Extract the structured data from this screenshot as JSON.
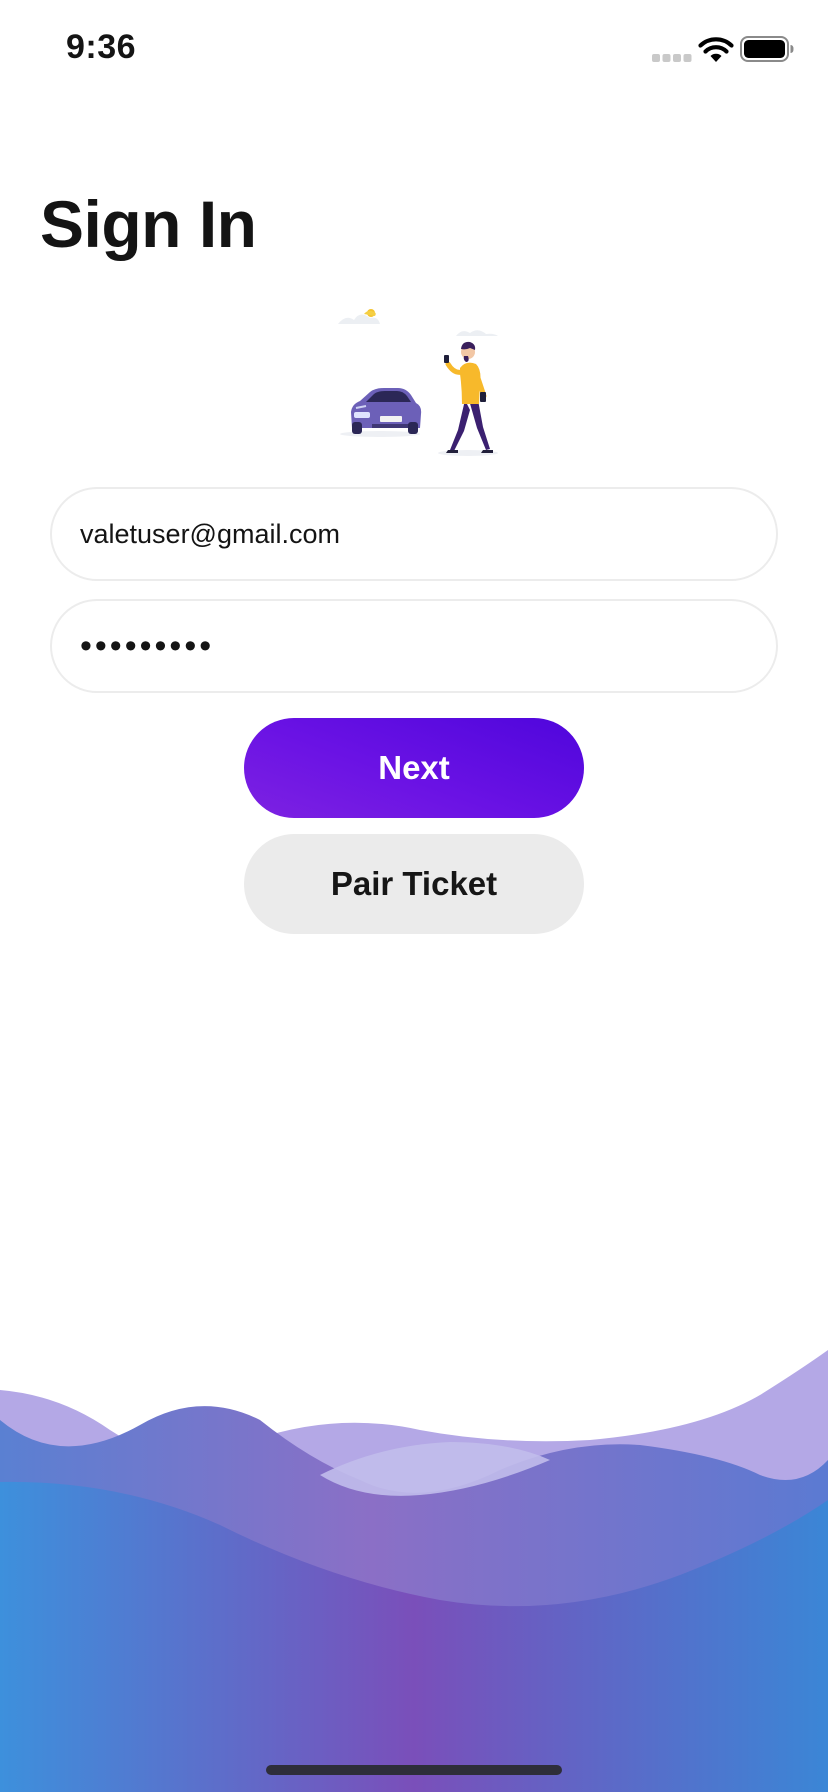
{
  "status_bar": {
    "time": "9:36",
    "icons": [
      "signal-icon",
      "wifi-icon",
      "battery-icon"
    ]
  },
  "page": {
    "title": "Sign In"
  },
  "illustration": {
    "icon": "car-and-person-illustration"
  },
  "form": {
    "email_value": "valetuser@gmail.com",
    "password_masked": "•••••••••"
  },
  "buttons": {
    "next_label": "Next",
    "pair_ticket_label": "Pair Ticket"
  },
  "colors": {
    "primary_purple": "#6a12e4",
    "secondary_button": "#ebebeb",
    "wave_blue": "#3a8ed8",
    "wave_violet": "#7a52bc",
    "wave_lavender": "#b4a8e6"
  }
}
